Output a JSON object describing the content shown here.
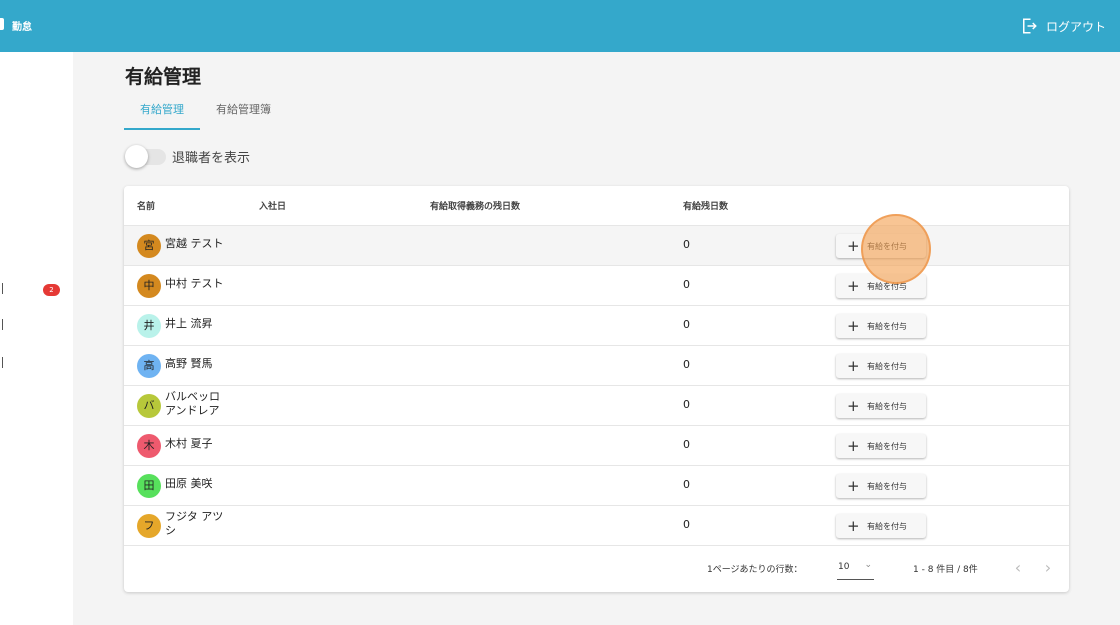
{
  "app": {
    "title": "勤怠"
  },
  "header": {
    "logout_label": "ログアウト"
  },
  "sidebar": {
    "badge_count": "2"
  },
  "page": {
    "title": "有給管理",
    "tabs": [
      {
        "label": "有給管理",
        "active": true
      },
      {
        "label": "有給管理簿",
        "active": false
      }
    ],
    "toggle_label": "退職者を表示"
  },
  "table": {
    "headers": {
      "name": "名前",
      "join_date": "入社日",
      "obligation_remaining": "有給取得義務の残日数",
      "remaining_days": "有給残日数"
    },
    "rows": [
      {
        "avatar": "宮",
        "avatar_color": "#d4891f",
        "name": "宮越 テスト",
        "remaining": "0",
        "button": "有給を付与"
      },
      {
        "avatar": "中",
        "avatar_color": "#d4891f",
        "name": "中村 テスト",
        "remaining": "0",
        "button": "有給を付与"
      },
      {
        "avatar": "井",
        "avatar_color": "#b9f2ea",
        "name": "井上 流昇",
        "remaining": "0",
        "button": "有給を付与"
      },
      {
        "avatar": "高",
        "avatar_color": "#6fb3f2",
        "name": "高野 賢馬",
        "remaining": "0",
        "button": "有給を付与"
      },
      {
        "avatar": "バ",
        "avatar_color": "#b7c83a",
        "name_line1": "バルベッロ",
        "name_line2": "アンドレア",
        "remaining": "0",
        "button": "有給を付与"
      },
      {
        "avatar": "木",
        "avatar_color": "#ee5a6e",
        "name": "木村 夏子",
        "remaining": "0",
        "button": "有給を付与"
      },
      {
        "avatar": "田",
        "avatar_color": "#57e05c",
        "name": "田原 美咲",
        "remaining": "0",
        "button": "有給を付与"
      },
      {
        "avatar": "フ",
        "avatar_color": "#e5a72a",
        "name_line1": "フジタ アツ",
        "name_line2": "シ",
        "remaining": "0",
        "button": "有給を付与"
      }
    ]
  },
  "pagination": {
    "rows_per_page_label": "1ページあたりの行数：",
    "rows_per_page_value": "10",
    "range_label": "1 - 8 件目 / 8件"
  },
  "colors": {
    "header_bg": "#34a8cb",
    "accent": "#34a8cb",
    "badge": "#e53935",
    "click_ripple": "#f3a252"
  }
}
